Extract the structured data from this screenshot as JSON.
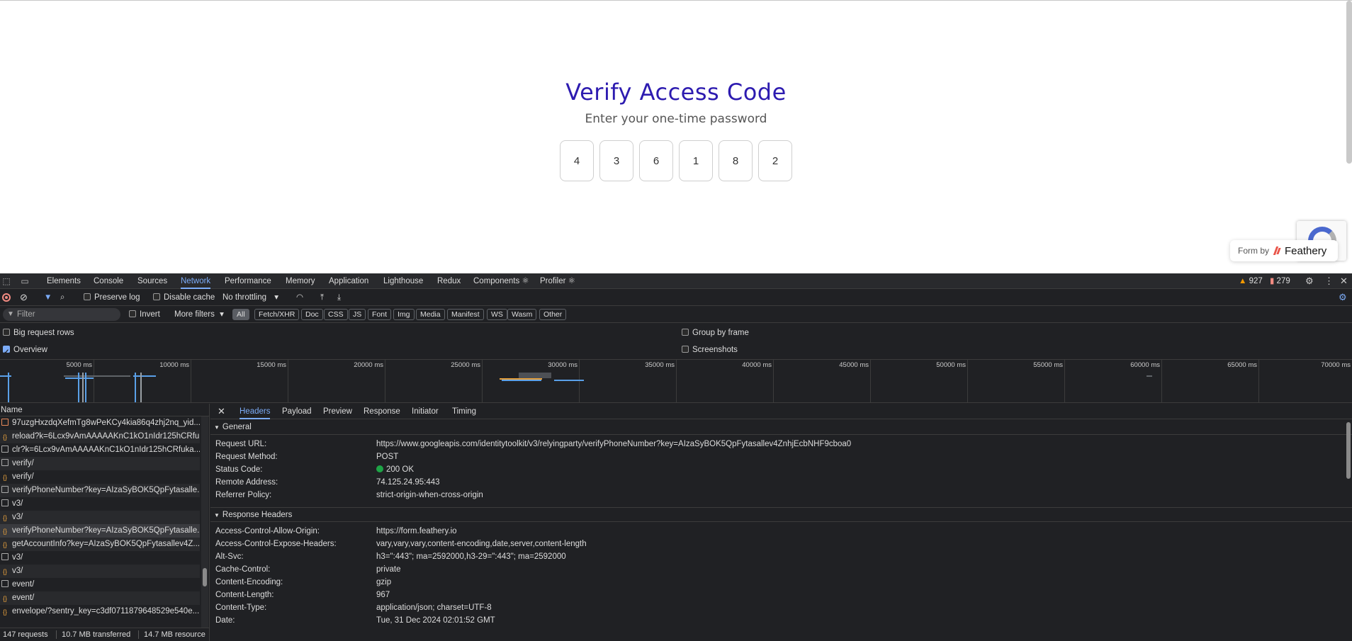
{
  "page": {
    "title": "Verify Access Code",
    "subtitle": "Enter your one-time password",
    "otp_digits": [
      "4",
      "3",
      "6",
      "1",
      "8",
      "2"
    ],
    "form_by_label": "Form by",
    "form_by_brand": "Feathery"
  },
  "devtools": {
    "tabs": [
      "Elements",
      "Console",
      "Sources",
      "Network",
      "Performance",
      "Memory",
      "Application",
      "Lighthouse",
      "Redux",
      "Components ⚛",
      "Profiler ⚛"
    ],
    "active_tab": "Network",
    "warnings_count": "927",
    "errors_count": "279",
    "toolbar": {
      "preserve_log": "Preserve log",
      "disable_cache": "Disable cache",
      "throttling": "No throttling"
    },
    "filter": {
      "placeholder": "Filter",
      "invert": "Invert",
      "more_filters": "More filters",
      "types": [
        "All",
        "Fetch/XHR",
        "Doc",
        "CSS",
        "JS",
        "Font",
        "Img",
        "Media",
        "Manifest",
        "WS",
        "Wasm",
        "Other"
      ]
    },
    "options": {
      "big_request_rows": "Big request rows",
      "overview": "Overview",
      "group_by_frame": "Group by frame",
      "screenshots": "Screenshots"
    },
    "timeline_labels": [
      "5000 ms",
      "10000 ms",
      "15000 ms",
      "20000 ms",
      "25000 ms",
      "30000 ms",
      "35000 ms",
      "40000 ms",
      "45000 ms",
      "50000 ms",
      "55000 ms",
      "60000 ms",
      "65000 ms",
      "70000 ms"
    ],
    "requests": {
      "name_header": "Name",
      "rows": [
        {
          "name": "97uzgHxzdqXefmTg8wPeKCy4kia86q4zhj2nq_yid...",
          "type": "img"
        },
        {
          "name": "reload?k=6Lcx9vAmAAAAAKnC1kO1nIdr125hCRfu...",
          "type": "xhr"
        },
        {
          "name": "clr?k=6Lcx9vAmAAAAAKnC1kO1nIdr125hCRfuka...",
          "type": "doc"
        },
        {
          "name": "verify/",
          "type": "doc"
        },
        {
          "name": "verify/",
          "type": "xhr"
        },
        {
          "name": "verifyPhoneNumber?key=AIzaSyBOK5QpFytasalle...",
          "type": "doc"
        },
        {
          "name": "v3/",
          "type": "doc"
        },
        {
          "name": "v3/",
          "type": "xhr"
        },
        {
          "name": "verifyPhoneNumber?key=AIzaSyBOK5QpFytasalle...",
          "type": "xhr"
        },
        {
          "name": "getAccountInfo?key=AIzaSyBOK5QpFytasallev4Z...",
          "type": "xhr"
        },
        {
          "name": "v3/",
          "type": "doc"
        },
        {
          "name": "v3/",
          "type": "xhr"
        },
        {
          "name": "event/",
          "type": "doc"
        },
        {
          "name": "event/",
          "type": "xhr"
        },
        {
          "name": "envelope/?sentry_key=c3df0711879648529e540e...",
          "type": "xhr"
        }
      ]
    },
    "status_bar": {
      "requests": "147 requests",
      "transferred": "10.7 MB transferred",
      "resources": "14.7 MB resource"
    },
    "detail": {
      "tabs": [
        "Headers",
        "Payload",
        "Preview",
        "Response",
        "Initiator",
        "Timing"
      ],
      "active_tab": "Headers",
      "general_title": "General",
      "general": [
        {
          "key": "Request URL:",
          "value": "https://www.googleapis.com/identitytoolkit/v3/relyingparty/verifyPhoneNumber?key=AIzaSyBOK5QpFytasallev4ZnhjEcbNHF9cboa0"
        },
        {
          "key": "Request Method:",
          "value": "POST"
        },
        {
          "key": "Status Code:",
          "value": "200 OK"
        },
        {
          "key": "Remote Address:",
          "value": "74.125.24.95:443"
        },
        {
          "key": "Referrer Policy:",
          "value": "strict-origin-when-cross-origin"
        }
      ],
      "response_title": "Response Headers",
      "response_headers": [
        {
          "key": "Access-Control-Allow-Origin:",
          "value": "https://form.feathery.io"
        },
        {
          "key": "Access-Control-Expose-Headers:",
          "value": "vary,vary,vary,content-encoding,date,server,content-length"
        },
        {
          "key": "Alt-Svc:",
          "value": "h3=\":443\"; ma=2592000,h3-29=\":443\"; ma=2592000"
        },
        {
          "key": "Cache-Control:",
          "value": "private"
        },
        {
          "key": "Content-Encoding:",
          "value": "gzip"
        },
        {
          "key": "Content-Length:",
          "value": "967"
        },
        {
          "key": "Content-Type:",
          "value": "application/json; charset=UTF-8"
        },
        {
          "key": "Date:",
          "value": "Tue, 31 Dec 2024 02:01:52 GMT"
        }
      ]
    }
  }
}
